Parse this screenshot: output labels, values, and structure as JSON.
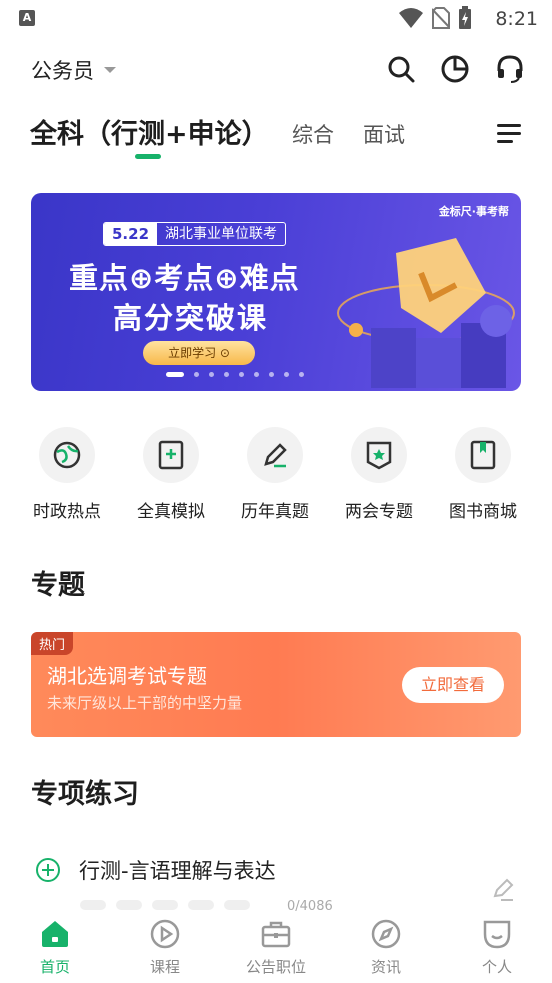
{
  "status_bar": {
    "time": "8:21"
  },
  "top_bar": {
    "exam_type": "公务员"
  },
  "subject_tabs": {
    "active": "全科（行测+申论）",
    "others": [
      "综合",
      "面试"
    ]
  },
  "banner": {
    "brand": "金标尺·事考帮",
    "date": "5.22",
    "tag": "湖北事业单位联考",
    "headline": "重点⊕考点⊕难点",
    "subheadline": "高分突破课",
    "cta": "立即学习 ⊙",
    "page_count": 9,
    "active_page": 1
  },
  "quick_entries": [
    {
      "label": "时政热点",
      "icon": "globe-icon"
    },
    {
      "label": "全真模拟",
      "icon": "exam-paper-icon"
    },
    {
      "label": "历年真题",
      "icon": "pencil-icon"
    },
    {
      "label": "两会专题",
      "icon": "star-badge-icon"
    },
    {
      "label": "图书商城",
      "icon": "book-icon"
    }
  ],
  "topics_section": {
    "title": "专题",
    "card": {
      "badge": "热门",
      "title": "湖北选调考试专题",
      "subtitle": "未来厅级以上干部的中坚力量",
      "button": "立即查看"
    }
  },
  "practice_section": {
    "title": "专项练习",
    "items": [
      {
        "name": "行测-言语理解与表达",
        "count": "0/4086"
      }
    ]
  },
  "bottom_nav": [
    {
      "label": "首页",
      "icon": "home-icon",
      "active": true
    },
    {
      "label": "课程",
      "icon": "play-circle-icon",
      "active": false
    },
    {
      "label": "公告职位",
      "icon": "briefcase-icon",
      "active": false
    },
    {
      "label": "资讯",
      "icon": "compass-icon",
      "active": false
    },
    {
      "label": "个人",
      "icon": "profile-face-icon",
      "active": false
    }
  ],
  "colors": {
    "accent": "#17b26a",
    "banner": "#3a36c8",
    "topic_card": "#ff7b52"
  }
}
